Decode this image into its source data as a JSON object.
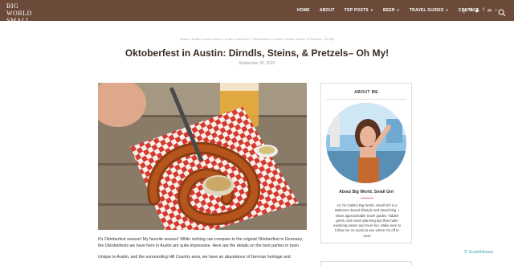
{
  "header": {
    "logo_line1": "Big World",
    "logo_line2": "Small Girl",
    "nav": [
      {
        "label": "HOME",
        "dropdown": false
      },
      {
        "label": "ABOUT",
        "dropdown": false
      },
      {
        "label": "TOP POSTS",
        "dropdown": true
      },
      {
        "label": "BEER",
        "dropdown": true
      },
      {
        "label": "TRAVEL GUIDES",
        "dropdown": true
      },
      {
        "label": "CONTACT",
        "dropdown": false
      }
    ],
    "social_icons": [
      "instagram-icon",
      "pinterest-icon",
      "youtube-icon",
      "facebook-icon",
      "email-icon",
      "tiktok-icon"
    ]
  },
  "article": {
    "breadcrumb": "Home » Austin Travel Guides » Austin Craft Beer » Oktoberfest in Austin: Dirndls, Steins, & Pretzels– Oh My!",
    "title": "Oktoberfest in Austin: Dirndls, Steins, & Pretzels– Oh My!",
    "date": "September 26, 2022",
    "paragraph1": "It's Oktoberfest season! My favorite season! While nothing can compare to the original Oktoberfest in Germany, the Oktoberfests we have here in Austin are quite impressive. Here are the details on the best parties in town.",
    "paragraph2": "Unique to Austin, and the surrounding Hill Country area, we have an abundance of German heritage and"
  },
  "sidebar": {
    "heading": "ABOUT ME",
    "name": "About Big World, Small Girl",
    "description": "Hi, I'm Caitlin! Big World, Small Girl is a Baltimore-based lifestyle and travel blog. I share approachable travel guides, hidden gems, and smart planning tips that make exploring easier and more fun. Make sure to follow me on social to see where I'm off to next!"
  },
  "watermark": "ScanMalware",
  "colors": {
    "header_bg": "#6b4a3a",
    "title": "#3a2a22",
    "accent": "#cc7766"
  }
}
